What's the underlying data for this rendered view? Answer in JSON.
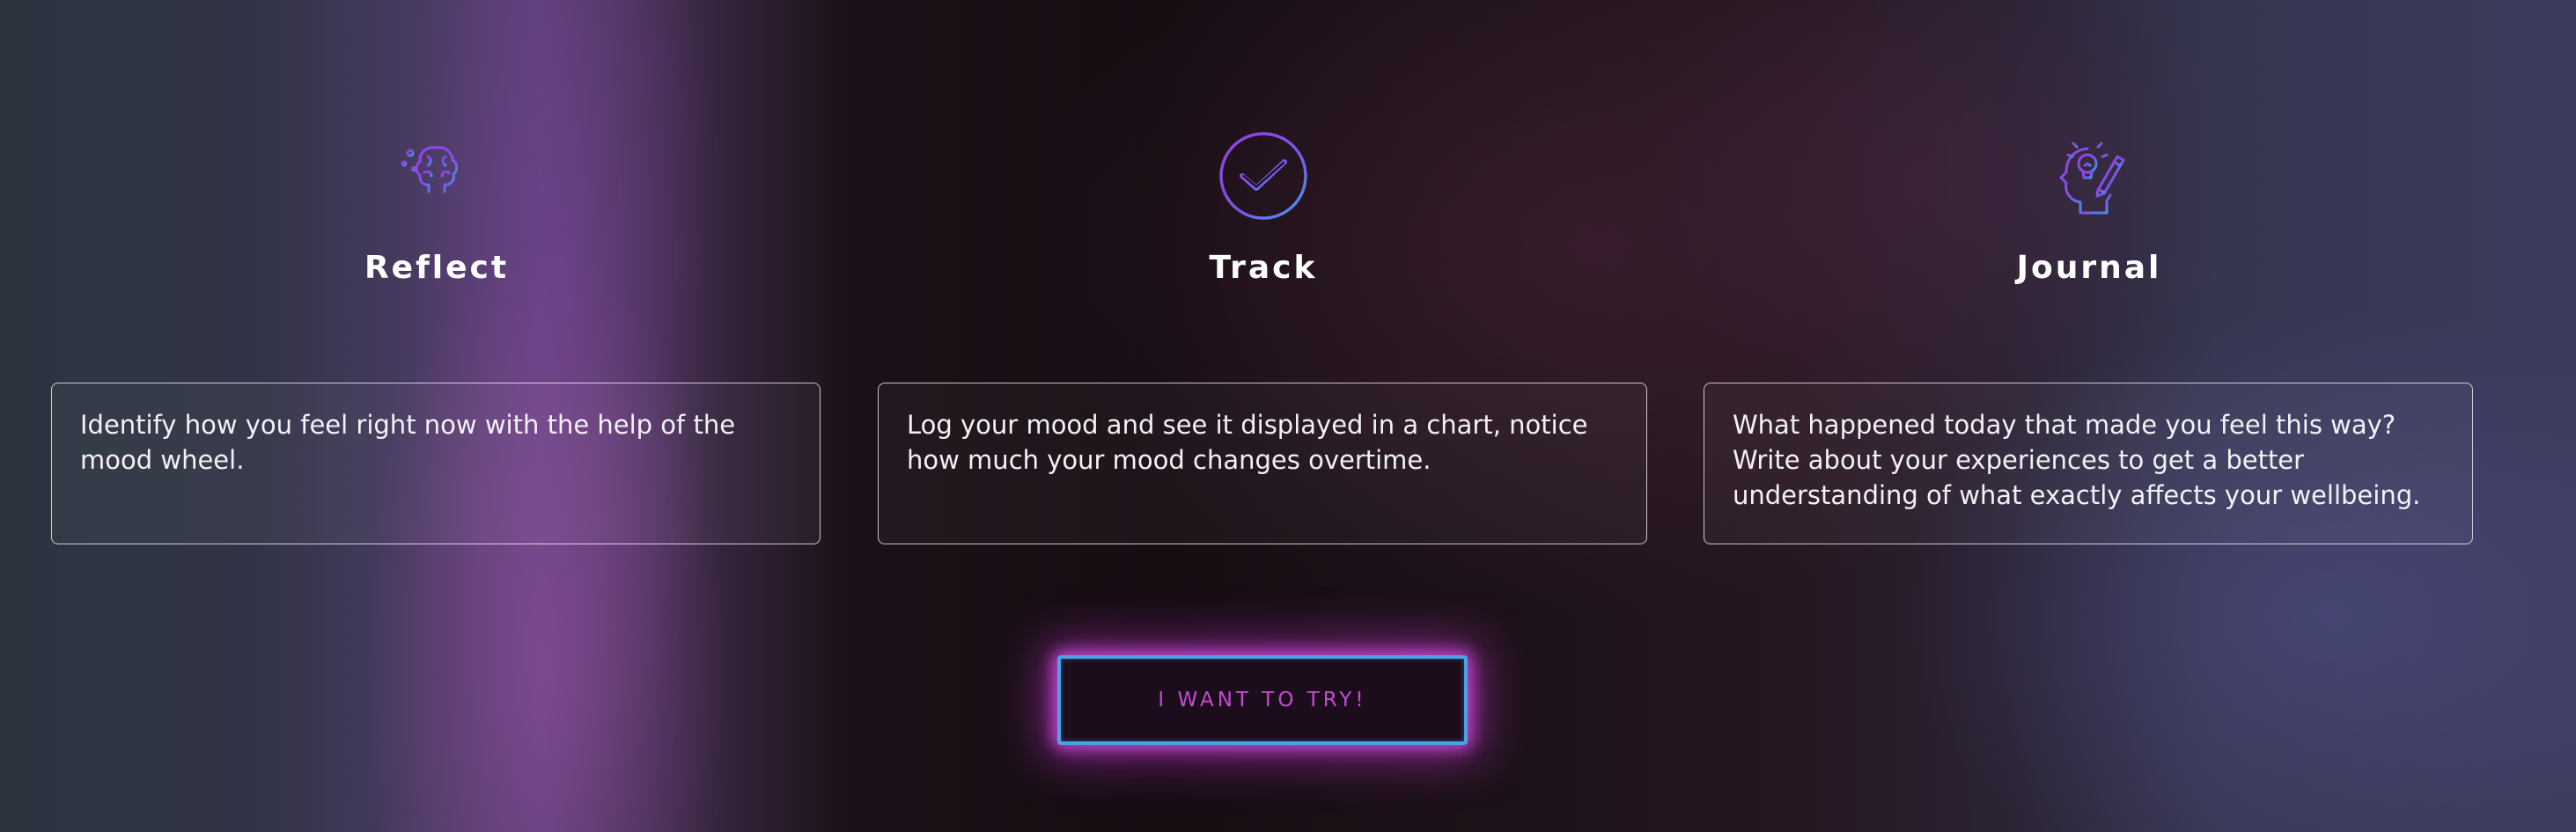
{
  "features": [
    {
      "icon": "brain-lightbulb-icon",
      "title": "Reflect",
      "description": "Identify how you feel right now with the help of the mood wheel."
    },
    {
      "icon": "check-circle-icon",
      "title": "Track",
      "description": "Log your mood and see it displayed in a chart, notice how much your mood changes overtime."
    },
    {
      "icon": "head-idea-pencil-icon",
      "title": "Journal",
      "description": "What happened today that made you feel this way? Write about your experiences to get a better understanding of what exactly affects your wellbeing."
    }
  ],
  "cta": {
    "label": "I WANT TO TRY!"
  },
  "colors": {
    "icon_gradient_start": "#8f3fe0",
    "icon_gradient_end": "#3f8ce8",
    "cta_border": "#4aa3e8",
    "cta_glow": "#e050eb",
    "cta_text": "#c44bd0"
  }
}
